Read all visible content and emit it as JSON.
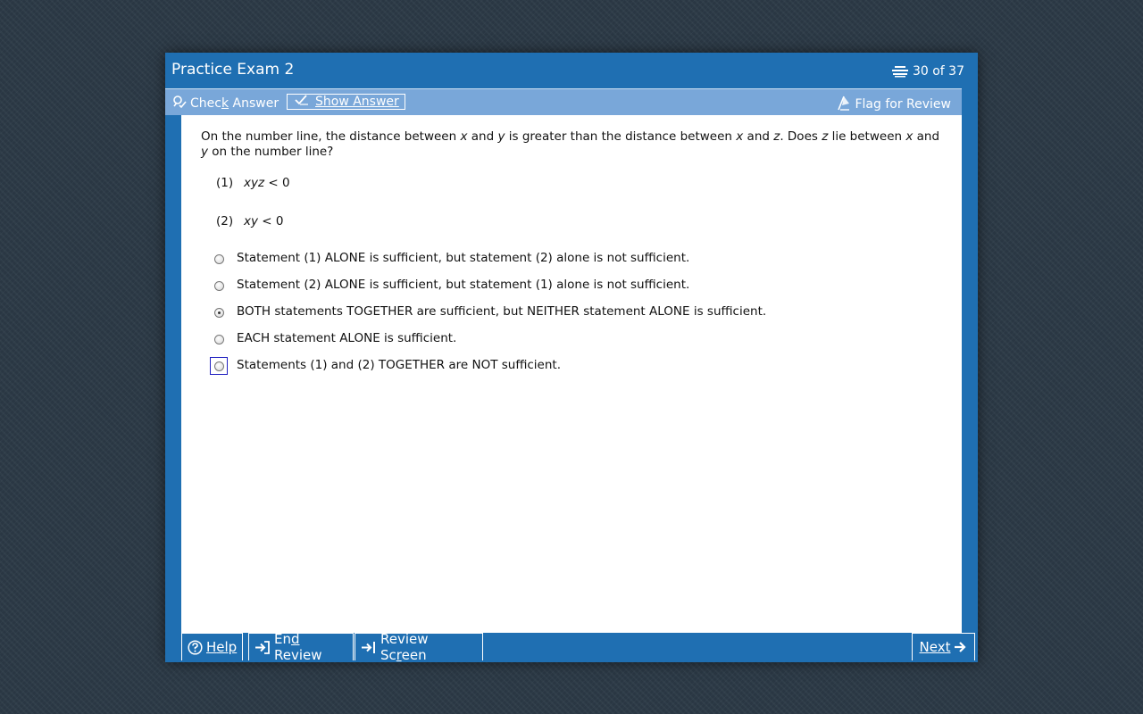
{
  "window": {
    "title": "Practice Exam 2",
    "counter": "30 of 37"
  },
  "toolbar": {
    "check_answer_pre": "Chec",
    "check_answer_key": "k",
    "check_answer_post": " Answer",
    "show_answer": "Show Answer",
    "flag_for_review": "Flag for Review"
  },
  "question": {
    "stem_parts": [
      "On the number line, the distance between ",
      "x",
      " and ",
      "y",
      " is greater than the distance between ",
      "x",
      " and ",
      "z",
      ". Does ",
      "z",
      " lie between ",
      "x",
      " and ",
      "y",
      " on the number line?"
    ],
    "statements": [
      {
        "num": "(1)",
        "expr": "xyz",
        "rest": " < 0"
      },
      {
        "num": "(2)",
        "expr": "xy",
        "rest": " < 0"
      }
    ],
    "options": [
      {
        "label": "Statement (1) ALONE is sufficient, but statement (2) alone is not sufficient."
      },
      {
        "label": "Statement (2) ALONE is sufficient, but statement (1) alone is not sufficient."
      },
      {
        "label": "BOTH statements TOGETHER are sufficient, but NEITHER statement ALONE is sufficient."
      },
      {
        "label": "EACH statement ALONE is sufficient."
      },
      {
        "label": "Statements (1) and (2) TOGETHER are NOT sufficient."
      }
    ],
    "selected_option": 2,
    "focused_option": 4
  },
  "footer": {
    "help_key": "H",
    "help_rest": "elp",
    "end_pre": "En",
    "end_key": "d",
    "end_post": " Review",
    "review_pre": "Review Sc",
    "review_key": "r",
    "review_post": "een",
    "next_key": "N",
    "next_rest": "ext"
  },
  "colors": {
    "window_blue": "#1f6fb2",
    "toolbar_blue": "#79a7d9",
    "background": "#2c3a47"
  }
}
